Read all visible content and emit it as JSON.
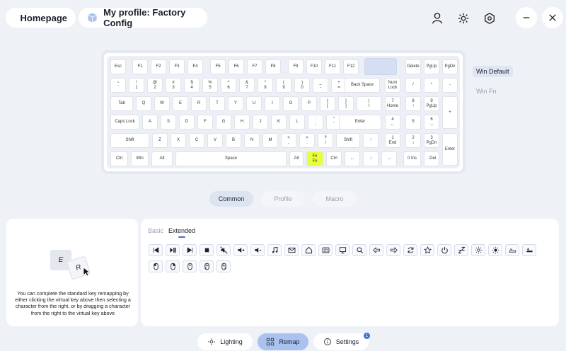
{
  "header": {
    "home_label": "Homepage",
    "profile_label": "My profile: Factory Config"
  },
  "keyboard": {
    "rows": [
      [
        [
          "Esc"
        ],
        [
          "F1"
        ],
        [
          "F2"
        ],
        [
          "F3"
        ],
        [
          "F4"
        ],
        [
          "F5"
        ],
        [
          "F6"
        ],
        [
          "F7"
        ],
        [
          "F8"
        ],
        [
          "F9"
        ],
        [
          "F10"
        ],
        [
          "F11"
        ],
        [
          "F12"
        ],
        [
          ""
        ],
        [
          "Delete"
        ],
        [
          "PgUp"
        ],
        [
          "PgDn"
        ]
      ],
      [
        [
          "~",
          "`"
        ],
        [
          "!",
          "1"
        ],
        [
          "@",
          "2"
        ],
        [
          "#",
          "3"
        ],
        [
          "$",
          "4"
        ],
        [
          "%",
          "5"
        ],
        [
          "^",
          "6"
        ],
        [
          "&",
          "7"
        ],
        [
          "*",
          "8"
        ],
        [
          "(",
          "9"
        ],
        [
          ")",
          "0"
        ],
        [
          "_",
          "-"
        ],
        [
          "+",
          "="
        ],
        [
          "Back Space"
        ],
        [
          "Num",
          "Lock"
        ],
        [
          "/"
        ],
        [
          "*"
        ],
        [
          "-"
        ]
      ],
      [
        [
          "Tab"
        ],
        [
          "Q"
        ],
        [
          "W"
        ],
        [
          "E"
        ],
        [
          "R"
        ],
        [
          "T"
        ],
        [
          "Y"
        ],
        [
          "U"
        ],
        [
          "I"
        ],
        [
          "O"
        ],
        [
          "P"
        ],
        [
          "{",
          "["
        ],
        [
          "}",
          "]"
        ],
        [
          "|",
          "\\"
        ],
        [
          "7",
          "Home"
        ],
        [
          "8",
          "↑"
        ],
        [
          "9",
          "PgUp"
        ],
        [
          "+"
        ]
      ],
      [
        [
          "Caps Lock"
        ],
        [
          "A"
        ],
        [
          "S"
        ],
        [
          "D"
        ],
        [
          "F"
        ],
        [
          "G"
        ],
        [
          "H"
        ],
        [
          "J"
        ],
        [
          "K"
        ],
        [
          "L"
        ],
        [
          ":",
          ";"
        ],
        [
          "\"",
          "'"
        ],
        [
          "Enter"
        ],
        [
          "4",
          "←"
        ],
        [
          "5"
        ],
        [
          "6",
          "→"
        ]
      ],
      [
        [
          "Shift"
        ],
        [
          "Z"
        ],
        [
          "X"
        ],
        [
          "C"
        ],
        [
          "V"
        ],
        [
          "B"
        ],
        [
          "N"
        ],
        [
          "M"
        ],
        [
          "<",
          ","
        ],
        [
          ">",
          "."
        ],
        [
          "?",
          "/"
        ],
        [
          "Shift"
        ],
        [
          "↑"
        ],
        [
          "1",
          "End"
        ],
        [
          "2",
          "↓"
        ],
        [
          "3",
          "PgDn"
        ],
        [
          "Enter"
        ]
      ],
      [
        [
          "Ctrl"
        ],
        [
          "Win"
        ],
        [
          "Alt"
        ],
        [
          "Space"
        ],
        [
          "Alt"
        ],
        [
          "Fn",
          "Fn"
        ],
        [
          "Ctrl"
        ],
        [
          "←"
        ],
        [
          "↓"
        ],
        [
          "→"
        ],
        [
          "0 Ins"
        ],
        [
          ". Del"
        ]
      ]
    ]
  },
  "layers": {
    "win_default": "Win Default",
    "win_fn": "Win Fn"
  },
  "mode_tabs": {
    "common": "Common",
    "profile": "Profile",
    "macro": "Macro"
  },
  "hint": {
    "key_e": "E",
    "key_r": "R",
    "text": "You can complete the standard key remapping by either clicking the virtual key above then selecting a character from the right, or by dragging a character from the right to the virtual key above"
  },
  "function_panel": {
    "tab_basic": "Basic",
    "tab_extended": "Extended",
    "row1_icons": [
      "prev-track-icon",
      "play-pause-icon",
      "next-track-icon",
      "stop-icon",
      "mute-icon",
      "volume-up-icon",
      "volume-down-icon",
      "music-icon",
      "mail-icon",
      "home-icon",
      "calculator-icon",
      "computer-icon",
      "search-icon",
      "back-icon",
      "forward-icon",
      "refresh-icon",
      "favorite-icon",
      "power-icon",
      "sleep-icon",
      "brightness-down-icon",
      "brightness-up-icon",
      "backlight-down-icon",
      "backlight-up-icon"
    ],
    "row2_icons": [
      "mouse-left-icon",
      "mouse-right-icon",
      "mouse-middle-icon",
      "mouse-back-icon",
      "mouse-forward-icon"
    ]
  },
  "bottom_nav": {
    "lighting": "Lighting",
    "remap": "Remap",
    "settings": "Settings",
    "settings_badge": "1"
  },
  "colors": {
    "accent": "#a9c2f0",
    "fn_highlight": "#e8ff3a",
    "background": "#eef1f6"
  }
}
